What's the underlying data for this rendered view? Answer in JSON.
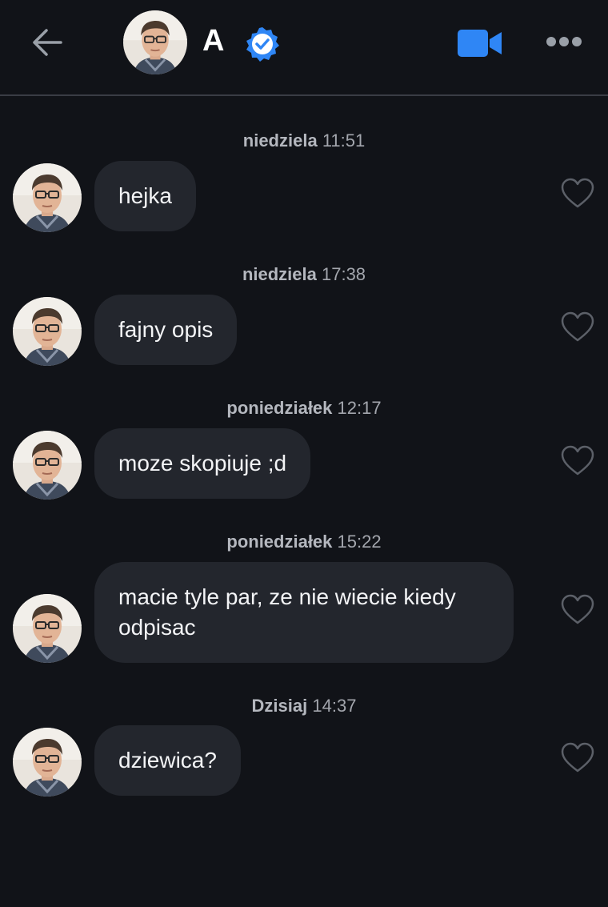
{
  "header": {
    "contact_name": "A",
    "back_icon": "arrow-left-icon",
    "verified_icon": "verified-badge-icon",
    "video_icon": "video-camera-icon",
    "more_icon": "more-dots-icon"
  },
  "colors": {
    "background": "#111318",
    "bubble": "#23262d",
    "accent": "#2f86f5",
    "timestamp": "#a3a6ad"
  },
  "messages": [
    {
      "day": "niedziela",
      "time": "11:51",
      "text": "hejka"
    },
    {
      "day": "niedziela",
      "time": "17:38",
      "text": "fajny opis"
    },
    {
      "day": "poniedziałek",
      "time": "12:17",
      "text": "moze skopiuje ;d"
    },
    {
      "day": "poniedziałek",
      "time": "15:22",
      "text": "macie tyle par, ze nie wiecie kiedy odpisac"
    },
    {
      "day": "Dzisiaj",
      "time": "14:37",
      "text": "dziewica?"
    }
  ]
}
